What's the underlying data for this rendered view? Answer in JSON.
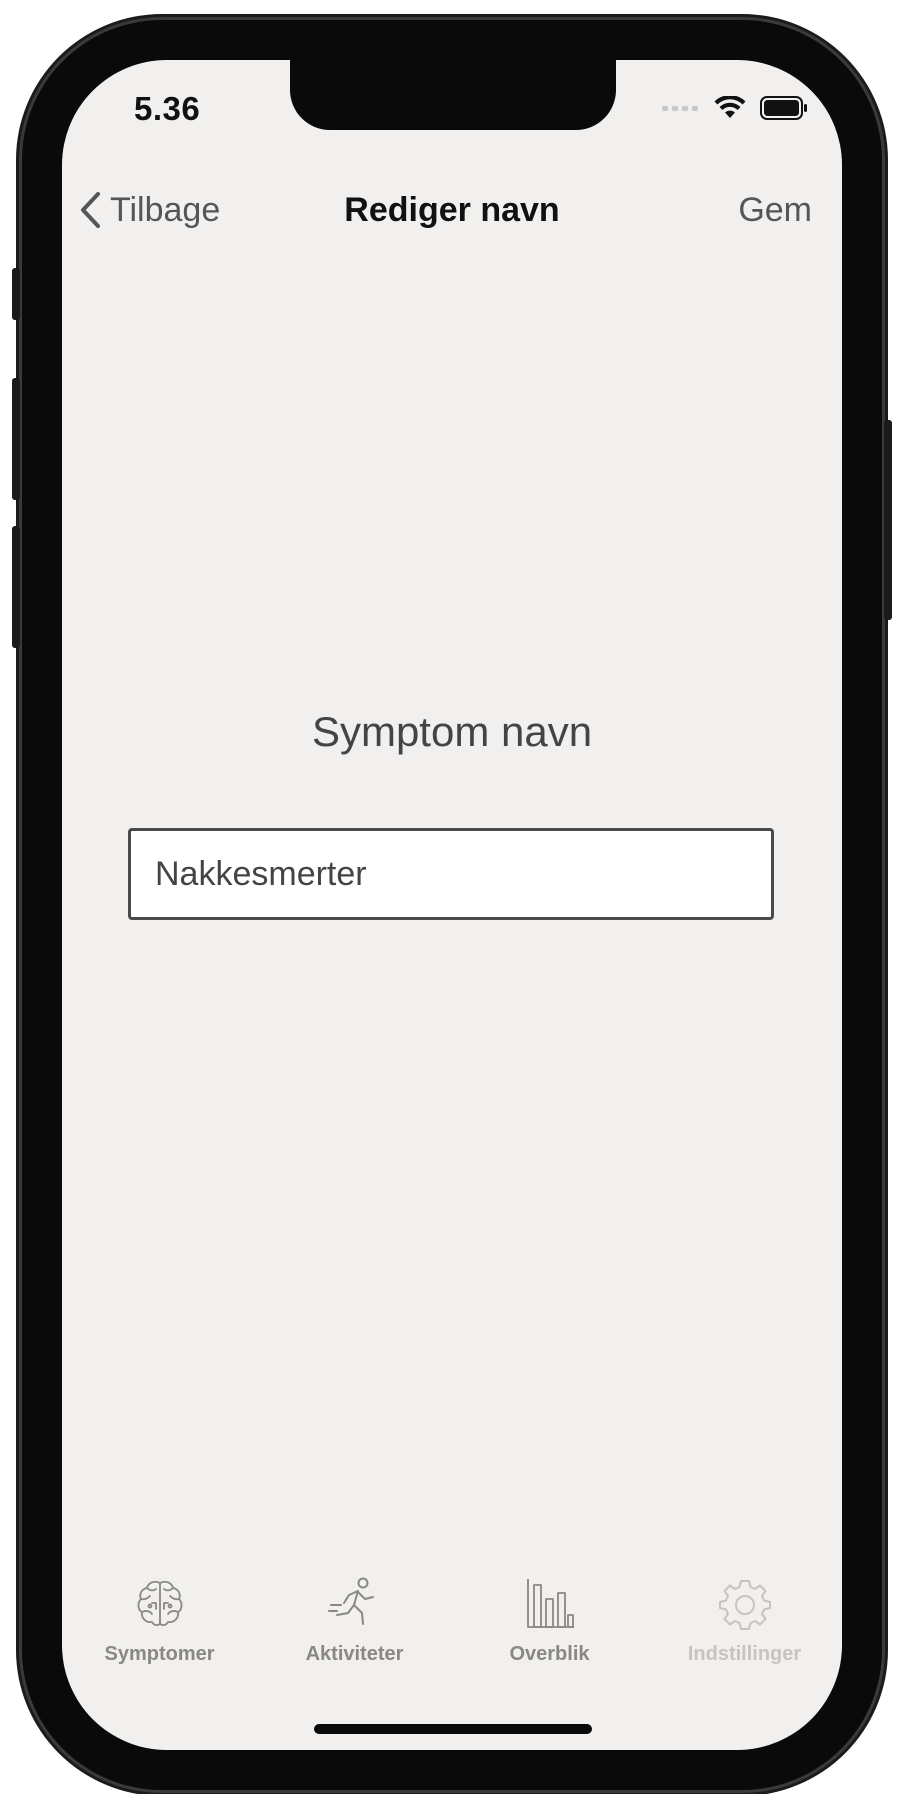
{
  "status_bar": {
    "time": "5.36",
    "icons": [
      "signal-icon",
      "wifi-icon",
      "battery-icon"
    ]
  },
  "nav": {
    "back_label": "Tilbage",
    "title": "Rediger navn",
    "save_label": "Gem"
  },
  "form": {
    "label": "Symptom navn",
    "input_value": "Nakkesmerter"
  },
  "tab_bar": {
    "tabs": [
      {
        "label": "Symptomer",
        "icon": "brain-icon"
      },
      {
        "label": "Aktiviteter",
        "icon": "running-person-icon"
      },
      {
        "label": "Overblik",
        "icon": "bar-chart-icon"
      },
      {
        "label": "Indstillinger",
        "icon": "gear-icon"
      }
    ]
  },
  "colors": {
    "background": "#f1f0ee",
    "text_primary": "#111111",
    "text_secondary": "#555555",
    "tab_label": "#8a8886",
    "tab_label_inactive": "#c9c2bd"
  }
}
